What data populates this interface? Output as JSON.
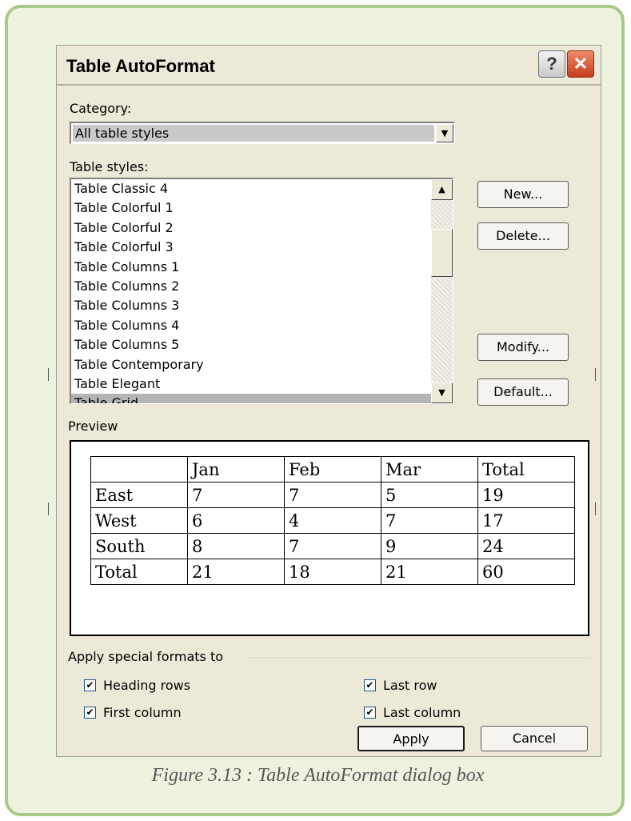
{
  "dialog": {
    "title": "Table AutoFormat",
    "help_symbol": "?",
    "close_symbol": "✕"
  },
  "category": {
    "label": "Category:",
    "value": "All table styles",
    "dropdown_arrow": "▼"
  },
  "table_styles": {
    "label": "Table styles:",
    "items": [
      "Table Classic 4",
      "Table Colorful 1",
      "Table Colorful 2",
      "Table Colorful 3",
      "Table Columns 1",
      "Table Columns 2",
      "Table Columns 3",
      "Table Columns 4",
      "Table Columns 5",
      "Table Contemporary",
      "Table Elegant",
      "Table Grid"
    ],
    "selected": "Table Grid",
    "scroll_up": "▲",
    "scroll_down": "▼"
  },
  "buttons": {
    "new": "New...",
    "delete": "Delete...",
    "modify": "Modify...",
    "default": "Default...",
    "apply": "Apply",
    "cancel": "Cancel"
  },
  "preview": {
    "label": "Preview",
    "rows": [
      [
        "",
        "Jan",
        "Feb",
        "Mar",
        "Total"
      ],
      [
        "East",
        "7",
        "7",
        "5",
        "19"
      ],
      [
        "West",
        "6",
        "4",
        "7",
        "17"
      ],
      [
        "South",
        "8",
        "7",
        "9",
        "24"
      ],
      [
        "Total",
        "21",
        "18",
        "21",
        "60"
      ]
    ]
  },
  "special_formats": {
    "label": "Apply special formats to",
    "options": {
      "heading_rows": {
        "label": "Heading rows",
        "checked": true
      },
      "first_column": {
        "label": "First column",
        "checked": true
      },
      "last_row": {
        "label": "Last row",
        "checked": true
      },
      "last_column": {
        "label": "Last column",
        "checked": true
      }
    },
    "check_glyph": "✔"
  },
  "caption": "Figure 3.13 : Table AutoFormat dialog box",
  "colors": {
    "frame_border": "#a9c98a",
    "frame_background": "#eef3df",
    "dialog_background": "#ece9d8",
    "selection": "#b4b4b4",
    "close_button": "#d9512f"
  },
  "icons": [
    "help-icon",
    "close-icon",
    "dropdown-arrow-icon",
    "scroll-up-icon",
    "scroll-down-icon",
    "checkbox-check-icon"
  ]
}
